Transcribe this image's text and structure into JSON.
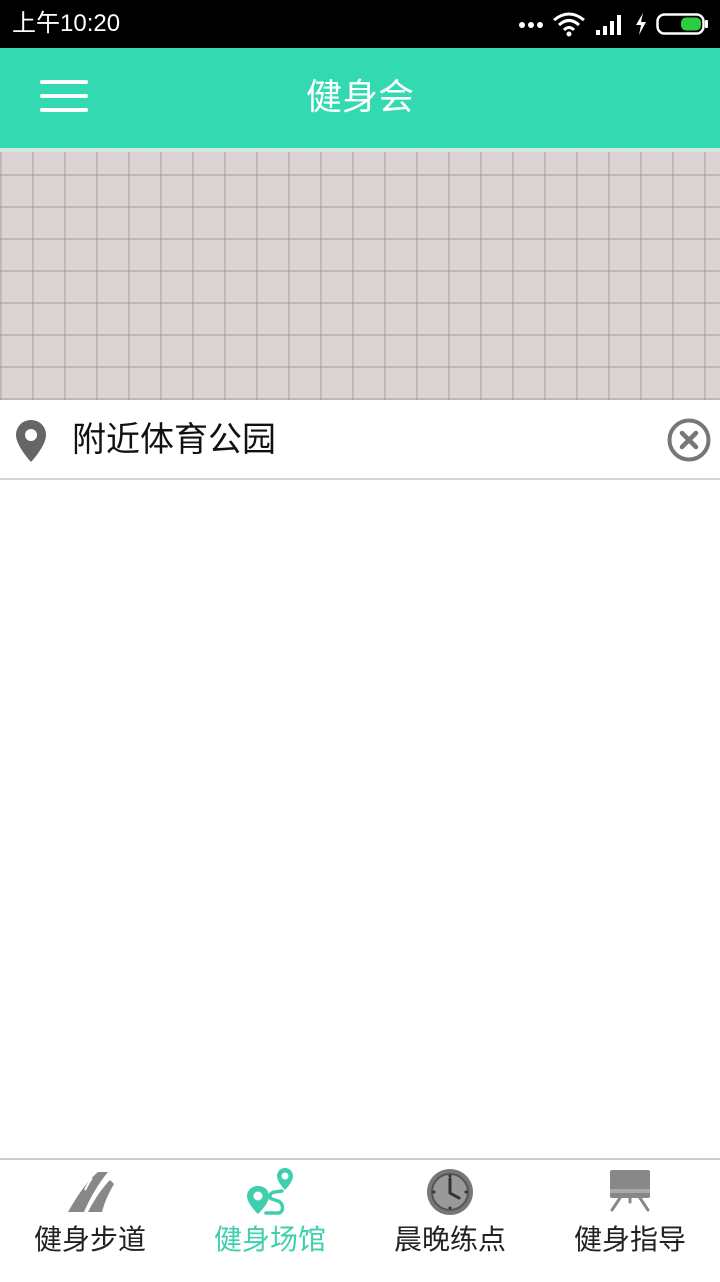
{
  "status_bar": {
    "time": "上午10:20"
  },
  "app_bar": {
    "title": "健身会"
  },
  "location_bar": {
    "text": "附近体育公园"
  },
  "bottom_nav": {
    "tabs": [
      {
        "label": "健身步道",
        "icon": "road-icon",
        "active": false
      },
      {
        "label": "健身场馆",
        "icon": "route-pin-icon",
        "active": true
      },
      {
        "label": "晨晚练点",
        "icon": "clock-icon",
        "active": false
      },
      {
        "label": "健身指导",
        "icon": "billboard-icon",
        "active": false
      }
    ]
  },
  "colors": {
    "accent": "#32d9b1",
    "active_tab": "#3fcfad",
    "map_background": "#dcd3d4",
    "battery": "#2ecc40"
  }
}
